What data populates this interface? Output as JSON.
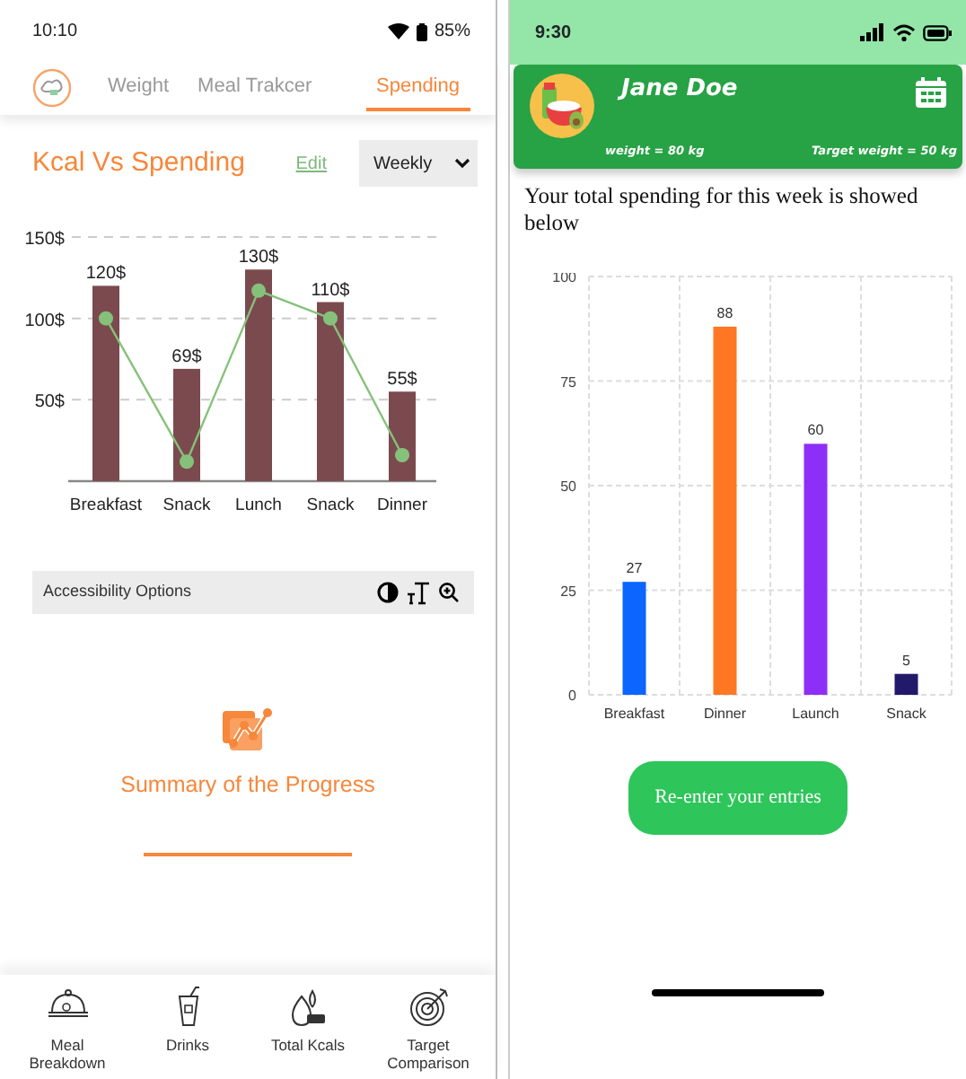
{
  "left_screen": {
    "status_bar": {
      "time": "10:10",
      "battery": "85%"
    },
    "tabs": [
      {
        "label": "Weight",
        "selected": false
      },
      {
        "label": "Meal Trakcer",
        "selected": false
      },
      {
        "label": "Spending",
        "selected": true
      }
    ],
    "title": "Kcal Vs Spending",
    "edit_link": "Edit",
    "period_select": {
      "value": "Weekly"
    },
    "chart_data": {
      "type": "bar",
      "categories": [
        "Breakfast",
        "Snack",
        "Lunch",
        "Snack",
        "Dinner"
      ],
      "series": [
        {
          "type": "bar",
          "color": "#7b4a4f",
          "values": [
            120,
            69,
            130,
            110,
            55
          ]
        },
        {
          "type": "line",
          "color": "#86c17b",
          "marker": "o",
          "values": [
            100,
            12,
            117,
            100,
            16
          ]
        }
      ],
      "ylim": [
        0,
        150
      ],
      "yticks": [
        {
          "value": 50,
          "label": "50$"
        },
        {
          "value": 100,
          "label": "100$"
        },
        {
          "value": 150,
          "label": "150$"
        }
      ],
      "value_labels": [
        "120$",
        "69$",
        "130$",
        "110$",
        "55$"
      ]
    },
    "accessibility_bar": {
      "label": "Accessibility Options"
    },
    "summary": {
      "title": "Summary of the Progress"
    },
    "bottom_nav": [
      {
        "kind": "cloche",
        "lines": [
          "Meal",
          "Breakdown"
        ]
      },
      {
        "kind": "drink",
        "lines": [
          "Drinks"
        ]
      },
      {
        "kind": "kcal",
        "lines": [
          "Total Kcals"
        ]
      },
      {
        "kind": "target",
        "lines": [
          "Target",
          "Comparison"
        ]
      }
    ]
  },
  "right_screen": {
    "status_bar": {
      "time": "9:30"
    },
    "profile": {
      "name": "Jane Doe",
      "weight": "weight = 80 kg",
      "target_weight": "Target weight = 50 kg"
    },
    "intro": "Your total spending for this week is showed below",
    "chart_data": {
      "type": "bar",
      "categories": [
        "Breakfast",
        "Dinner",
        "Launch",
        "Snack"
      ],
      "series": [
        {
          "values": [
            27,
            88,
            60,
            5
          ],
          "colors": [
            "#0a66ff",
            "#ff7722",
            "#8e2ff7",
            "#22196b"
          ]
        }
      ],
      "ylim": [
        0,
        100
      ],
      "yticks": [
        0,
        25,
        50,
        75,
        100
      ],
      "data_labels": true,
      "grid": true
    },
    "button": "Re-enter your entries"
  }
}
